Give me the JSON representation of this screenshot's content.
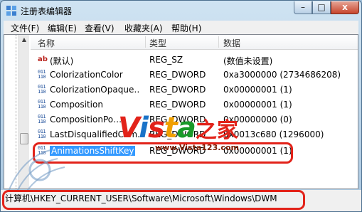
{
  "window": {
    "title": "注册表编辑器",
    "controls": {
      "minimize": "–",
      "maximize": "□",
      "close": "x"
    }
  },
  "menu": [
    "文件(F)",
    "编辑(E)",
    "查看(V)",
    "收藏夹(A)",
    "帮助(H)"
  ],
  "columns": {
    "name": "名称",
    "type": "类型",
    "data": "数据"
  },
  "rows": [
    {
      "icon": "string-value-icon",
      "icon_text": "ab",
      "name": "(默认)",
      "type": "REG_SZ",
      "data": "(数值未设置)"
    },
    {
      "icon": "binary-value-icon",
      "name": "ColorizationColor",
      "type": "REG_DWORD",
      "data": "0xa3000000 (2734686208)"
    },
    {
      "icon": "binary-value-icon",
      "name": "ColorizationOpaque…",
      "type": "REG_DWORD",
      "data": "0x00000001 (1)"
    },
    {
      "icon": "binary-value-icon",
      "name": "Composition",
      "type": "REG_DWORD",
      "data": "0x00000001 (1)"
    },
    {
      "icon": "binary-value-icon",
      "name": "CompositionPo…",
      "type": "REG_DWORD",
      "data": "0x00000000 (0)"
    },
    {
      "icon": "binary-value-icon",
      "name": "LastDisqualifiedCom…",
      "type": "REG_DWORD",
      "data": "0x0013c680 (1296000)"
    },
    {
      "icon": "binary-value-icon",
      "name": "AnimationsShiftKey",
      "type": "REG_DWORD",
      "data": "0x00000001 (1)",
      "selected": true
    }
  ],
  "status_path": "计算机\\HKEY_CURRENT_USER\\Software\\Microsoft\\Windows\\DWM",
  "watermark": {
    "vista_letters": [
      "V",
      "i",
      "s",
      "t",
      "a"
    ],
    "vista_colors": [
      "#e2231a",
      "#1a73c8",
      "#e2231a",
      "#f0a000",
      "#1a9a2a"
    ],
    "chinese": "之家",
    "url": "www.Vista123.com"
  },
  "colors": {
    "highlight_box": "#e2231a",
    "selection": "#3399ff"
  },
  "bin_icon_text": "011\n110"
}
